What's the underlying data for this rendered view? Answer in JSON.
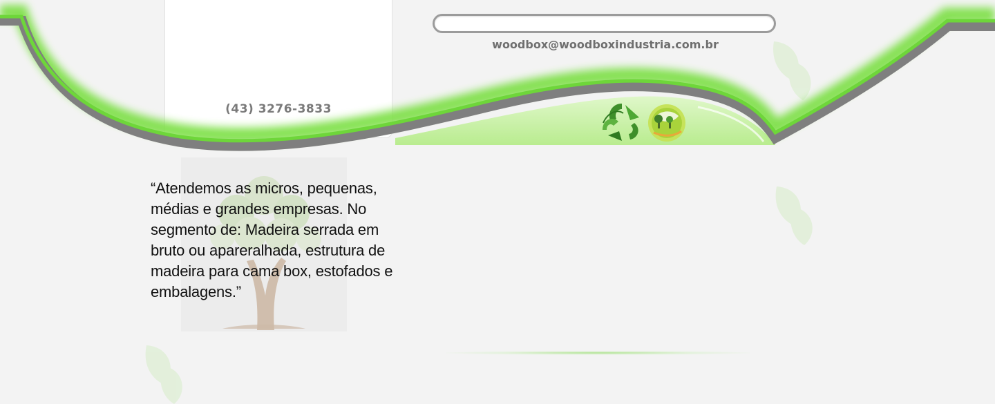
{
  "header": {
    "phone": "(43) 3276-3833",
    "email": "woodbox@woodboxindustria.com.br",
    "search": {
      "placeholder": "",
      "value": ""
    }
  },
  "intro": {
    "quote": "“Atendemos as micros, pequenas, médias e grandes empresas. No segmento de: Madeira serrada em bruto ou apareralhada, estrutura de madeira para cama box, estofados e embalagens.”"
  },
  "icons": {
    "recycle": "recycle-leaf-icon",
    "globe": "eco-globe-icon",
    "leaf": "leaf-icon",
    "tree": "tree-icon"
  },
  "colors": {
    "accent_green": "#7fe04a",
    "light_green": "#c6f2a4",
    "band_gray": "#808080",
    "background": "#f3f3f3",
    "text_dark": "#111111",
    "text_gray": "#7a7a7a"
  }
}
